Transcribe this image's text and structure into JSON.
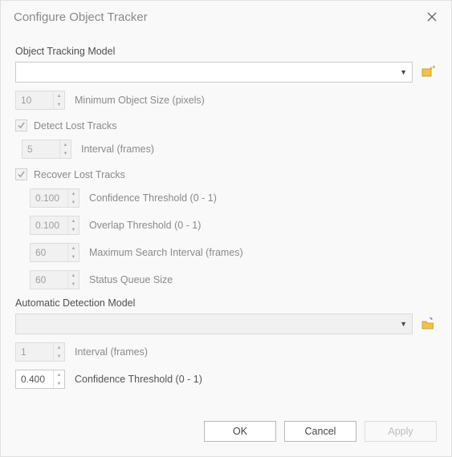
{
  "window": {
    "title": "Configure Object Tracker"
  },
  "trackingModel": {
    "label": "Object Tracking Model",
    "value": "",
    "sideIcon": "model-picker-icon"
  },
  "minObjectSize": {
    "value": "10",
    "label": "Minimum Object Size (pixels)"
  },
  "detectLost": {
    "label": "Detect Lost Tracks",
    "checked": true,
    "interval": {
      "value": "5",
      "label": "Interval (frames)"
    }
  },
  "recoverLost": {
    "label": "Recover Lost Tracks",
    "checked": true,
    "confThreshold": {
      "value": "0.100",
      "label": "Confidence Threshold (0 - 1)"
    },
    "overlapThreshold": {
      "value": "0.100",
      "label": "Overlap Threshold (0 - 1)"
    },
    "maxSearchInterval": {
      "value": "60",
      "label": "Maximum Search Interval (frames)"
    },
    "statusQueueSize": {
      "value": "60",
      "label": "Status Queue Size"
    }
  },
  "detectionModel": {
    "label": "Automatic Detection Model",
    "value": "",
    "sideIcon": "folder-open-icon"
  },
  "detInterval": {
    "value": "1",
    "label": "Interval (frames)"
  },
  "detConfThreshold": {
    "value": "0.400",
    "label": "Confidence Threshold (0 - 1)"
  },
  "buttons": {
    "ok": "OK",
    "cancel": "Cancel",
    "apply": "Apply"
  }
}
